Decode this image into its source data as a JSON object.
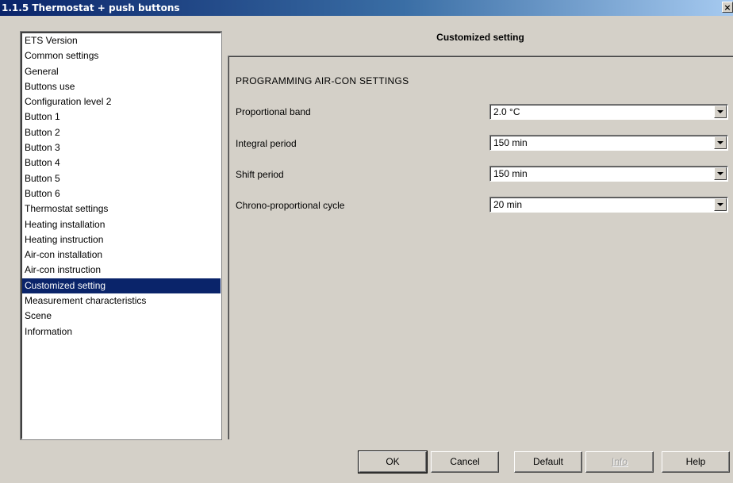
{
  "window": {
    "title": "1.1.5 Thermostat + push buttons",
    "close_glyph": "×"
  },
  "nav": {
    "items": [
      "ETS Version",
      "Common settings",
      "General",
      "Buttons use",
      "Configuration level 2",
      "Button 1",
      "Button 2",
      "Button 3",
      "Button 4",
      "Button 5",
      "Button 6",
      "Thermostat settings",
      "Heating installation",
      "Heating instruction",
      "Air-con installation",
      "Air-con instruction",
      "Customized setting",
      "Measurement characteristics",
      "Scene",
      "Information"
    ],
    "selected": "Customized setting"
  },
  "panel": {
    "title": "Customized setting",
    "section_heading": "PROGRAMMING AIR-CON SETTINGS",
    "rows": [
      {
        "label": "Proportional band",
        "value": "2.0 °C"
      },
      {
        "label": "Integral period",
        "value": "150 min"
      },
      {
        "label": "Shift period",
        "value": "150 min"
      },
      {
        "label": "Chrono-proportional cycle",
        "value": "20 min"
      }
    ]
  },
  "buttons": {
    "ok": "OK",
    "cancel": "Cancel",
    "default": "Default",
    "info": "Info",
    "help": "Help"
  },
  "colors": {
    "face": "#d4d0c8",
    "selection": "#0a246a",
    "title_start": "#0a246a",
    "title_end": "#a6caf0"
  }
}
